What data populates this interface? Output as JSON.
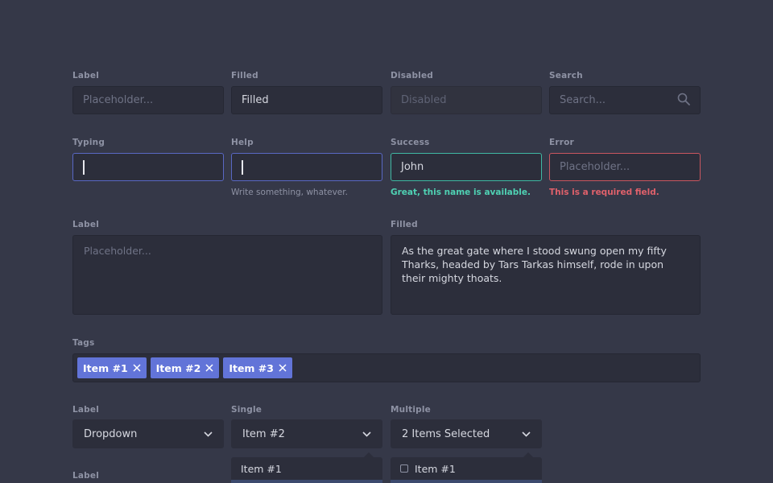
{
  "row1": {
    "label": {
      "label": "Label",
      "placeholder": "Placeholder..."
    },
    "filled": {
      "label": "Filled",
      "value": "Filled"
    },
    "disabled": {
      "label": "Disabled",
      "value": "Disabled"
    },
    "search": {
      "label": "Search",
      "placeholder": "Search...",
      "icon": "search-icon"
    }
  },
  "row2": {
    "typing": {
      "label": "Typing"
    },
    "help": {
      "label": "Help",
      "hint": "Write something, whatever."
    },
    "success": {
      "label": "Success",
      "value": "John",
      "hint": "Great, this name is available."
    },
    "error": {
      "label": "Error",
      "placeholder": "Placeholder...",
      "hint": "This is a required field."
    }
  },
  "textareas": {
    "empty": {
      "label": "Label",
      "placeholder": "Placeholder..."
    },
    "filled": {
      "label": "Filled",
      "value": "As the great gate where I stood swung open my fifty Tharks, headed by Tars Tarkas himself, rode in upon their mighty thoats."
    }
  },
  "tags": {
    "label": "Tags",
    "items": [
      "Item #1",
      "Item #2",
      "Item #3"
    ]
  },
  "dropdowns": {
    "basic": {
      "label": "Label",
      "value": "Dropdown"
    },
    "single": {
      "label": "Single",
      "value": "Item #2",
      "options": [
        "Item #1"
      ]
    },
    "multiple": {
      "label": "Multiple",
      "value": "2 Items Selected",
      "options": [
        "Item #1"
      ]
    }
  },
  "bottom": {
    "label": "Label"
  },
  "colors": {
    "background": "#353848",
    "field": "#2c2e3b",
    "accent": "#6274d8",
    "focus": "#5968c4",
    "success": "#3fb8a3",
    "error": "#c9565f"
  }
}
